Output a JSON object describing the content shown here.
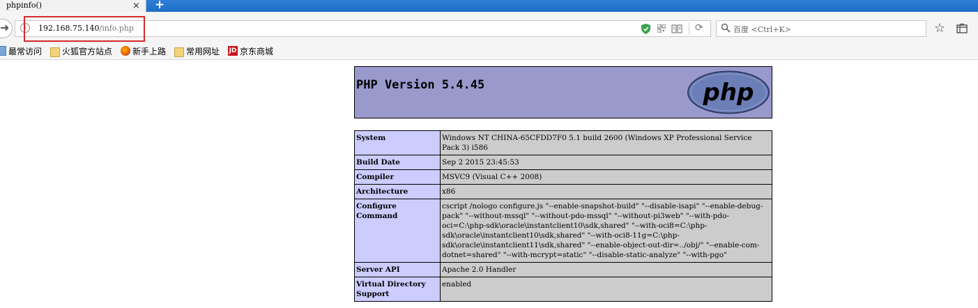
{
  "browser": {
    "tab": {
      "title": "phpinfo()",
      "close": "×"
    },
    "new_tab": "+",
    "url": {
      "host": "192.168.75.140",
      "path": "/info.php"
    },
    "search": {
      "placeholder": "百度 <Ctrl+K>"
    },
    "bookmarks": [
      {
        "label": "最常访问",
        "icon": "most-visited-icon"
      },
      {
        "label": "火狐官方站点",
        "icon": "folder-icon"
      },
      {
        "label": "新手上路",
        "icon": "firefox-icon"
      },
      {
        "label": "常用网址",
        "icon": "folder-icon"
      },
      {
        "label": "京东商城",
        "icon": "jd-icon",
        "icon_text": "JD"
      }
    ],
    "colors": {
      "highlight": "#d62b2b",
      "tab_strip": "#2f7fd6"
    }
  },
  "phpinfo": {
    "version_title": "PHP Version 5.4.45",
    "logo_text": "php",
    "colors": {
      "header": "#9999cc",
      "key": "#ccccff",
      "value": "#cccccc"
    },
    "rows": [
      {
        "key": "System",
        "value": "Windows NT CHINA-65CFDD7F0 5.1 build 2600 (Windows XP Professional Service Pack 3) i586"
      },
      {
        "key": "Build Date",
        "value": "Sep 2 2015 23:45:53"
      },
      {
        "key": "Compiler",
        "value": "MSVC9 (Visual C++ 2008)"
      },
      {
        "key": "Architecture",
        "value": "x86"
      },
      {
        "key": "Configure Command",
        "value": "cscript /nologo configure.js \"--enable-snapshot-build\" \"--disable-isapi\" \"--enable-debug-pack\" \"--without-mssql\" \"--without-pdo-mssql\" \"--without-pi3web\" \"--with-pdo-oci=C:\\php-sdk\\oracle\\instantclient10\\sdk,shared\" \"--with-oci8=C:\\php-sdk\\oracle\\instantclient10\\sdk,shared\" \"--with-oci8-11g=C:\\php-sdk\\oracle\\instantclient11\\sdk,shared\" \"--enable-object-out-dir=../obj/\" \"--enable-com-dotnet=shared\" \"--with-mcrypt=static\" \"--disable-static-analyze\" \"--with-pgo\""
      },
      {
        "key": "Server API",
        "value": "Apache 2.0 Handler"
      },
      {
        "key": "Virtual Directory Support",
        "value": "enabled"
      }
    ]
  }
}
